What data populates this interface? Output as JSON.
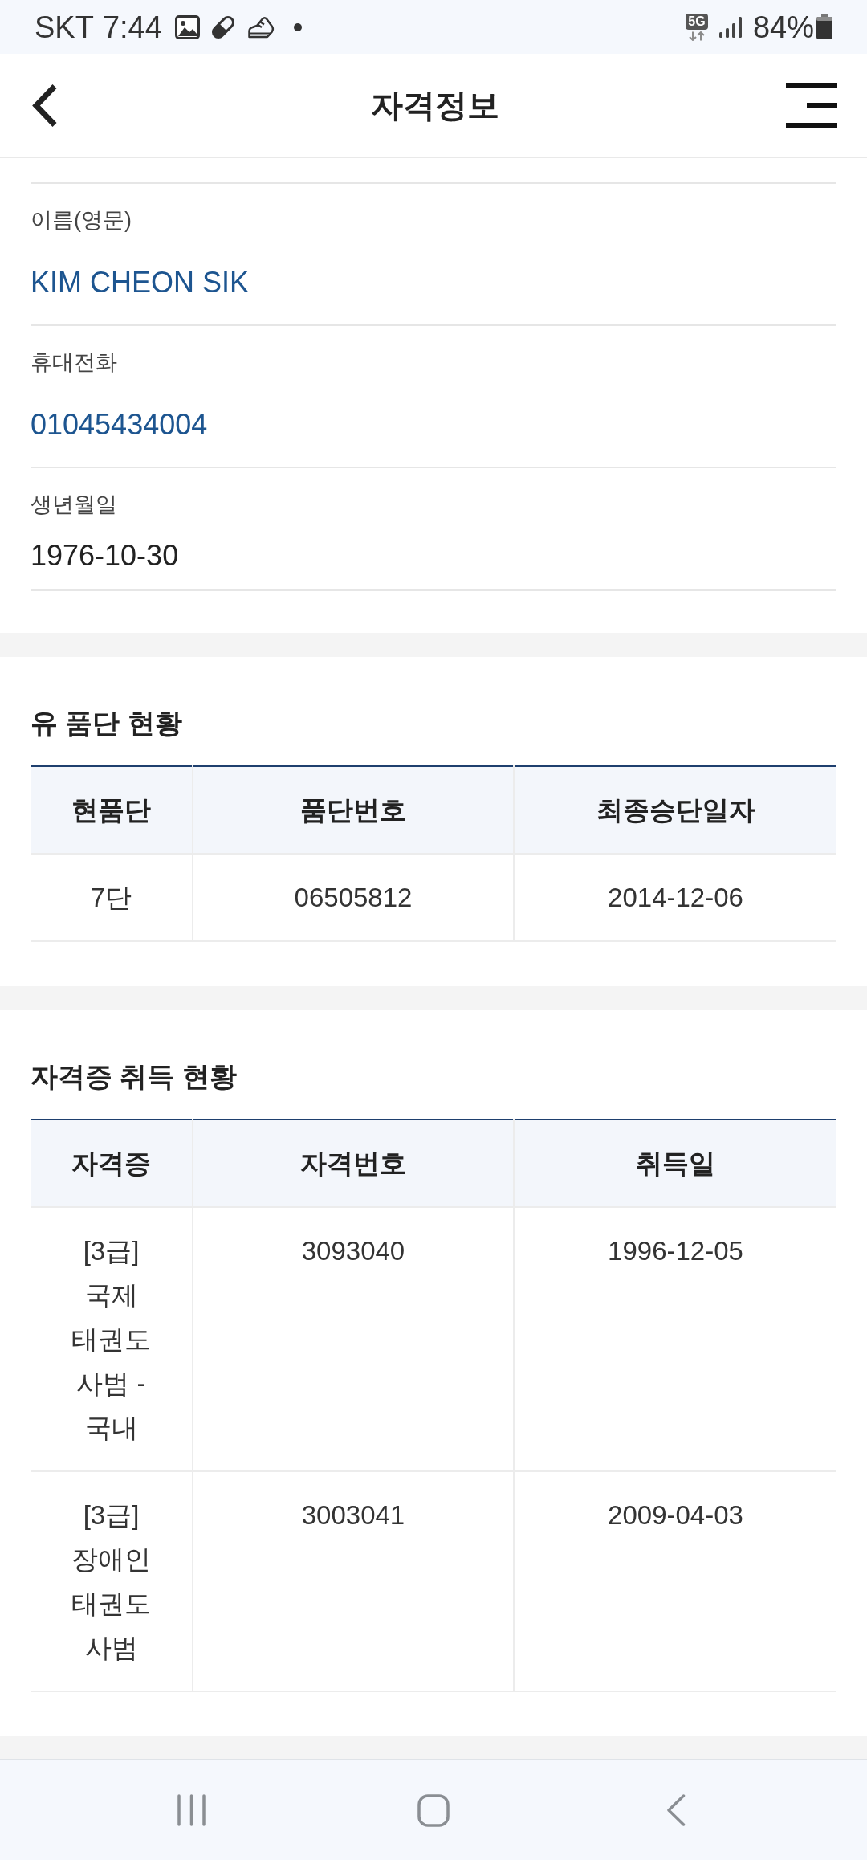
{
  "status_bar": {
    "carrier": "SKT",
    "time": "7:44",
    "network": "5G",
    "battery": "84%"
  },
  "header": {
    "title": "자격정보"
  },
  "profile_fields": [
    {
      "label": "이름(영문)",
      "value": "KIM CHEON SIK",
      "kind": "accent"
    },
    {
      "label": "휴대전화",
      "value": "01045434004",
      "kind": "accent"
    },
    {
      "label": "생년월일",
      "value": "1976-10-30",
      "kind": "plain"
    }
  ],
  "sections": [
    {
      "title": "유 품단 현황",
      "table": {
        "columns": [
          "현품단",
          "품단번호",
          "최종승단일자"
        ],
        "rows": [
          [
            "7단",
            "06505812",
            "2014-12-06"
          ]
        ]
      }
    },
    {
      "title": "자격증 취득 현황",
      "table": {
        "columns": [
          "자격증",
          "자격번호",
          "취득일"
        ],
        "rows": [
          [
            "[3급] 국제 태권도 사범 - 국내",
            "3093040",
            "1996-12-05"
          ],
          [
            "[3급] 장애인 태권도 사범",
            "3003041",
            "2009-04-03"
          ]
        ]
      }
    }
  ]
}
